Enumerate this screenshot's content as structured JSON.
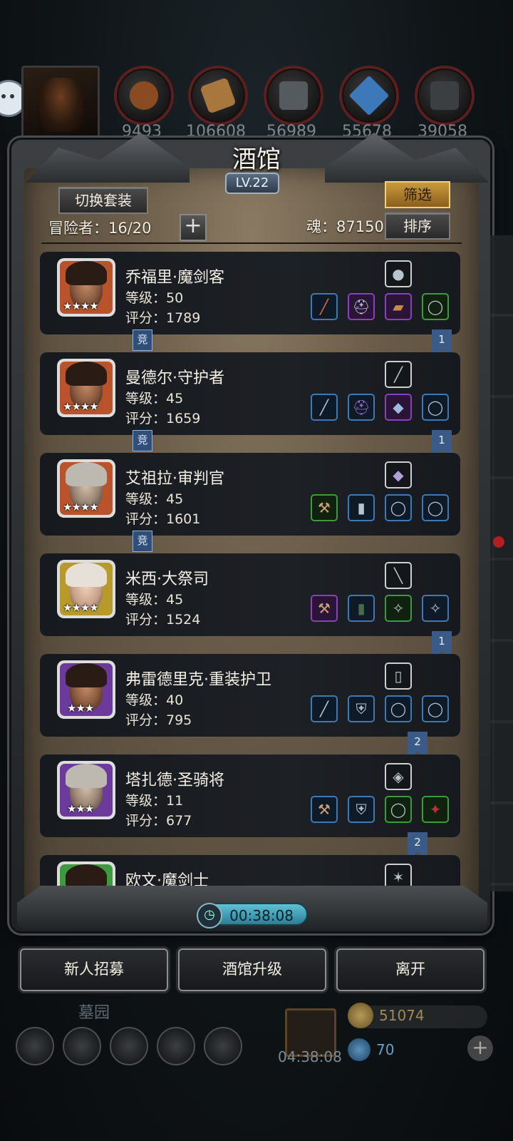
{
  "top_bar": {
    "resources": [
      {
        "name": "meat",
        "value": "9493"
      },
      {
        "name": "wood",
        "value": "106608"
      },
      {
        "name": "stone",
        "value": "56989"
      },
      {
        "name": "crystal",
        "value": "55678"
      },
      {
        "name": "iron",
        "value": "39058"
      }
    ]
  },
  "panel": {
    "title": "酒馆",
    "level": "LV.22",
    "switch_outfit_label": "切换套装",
    "filter_label": "筛选",
    "sort_label": "排序",
    "adventurers_label": "冒险者：16/20",
    "add_label": "+",
    "soul_label": "魂：87150"
  },
  "heroes": [
    {
      "name": "乔福里·魔剑客",
      "level": "等级：50",
      "score": "评分：1789",
      "stars": "★★★★",
      "frame_color": "#b8532b",
      "face": "dark",
      "competing": "竞",
      "ribbon": "1"
    },
    {
      "name": "曼德尔·守护者",
      "level": "等级：45",
      "score": "评分：1659",
      "stars": "★★★★",
      "frame_color": "#b8532b",
      "face": "dark",
      "competing": "竞",
      "ribbon": "1"
    },
    {
      "name": "艾祖拉·审判官",
      "level": "等级：45",
      "score": "评分：1601",
      "stars": "★★★★",
      "frame_color": "#b8532b",
      "face": "old",
      "competing": "竞",
      "ribbon": ""
    },
    {
      "name": "米西·大祭司",
      "level": "等级：45",
      "score": "评分：1524",
      "stars": "★★★★",
      "frame_color": "#b79a2a",
      "face": "light",
      "competing": "",
      "ribbon": "1"
    },
    {
      "name": "弗雷德里克·重装护卫",
      "level": "等级：40",
      "score": "评分：795",
      "stars": "★★★",
      "frame_color": "#6b3a9a",
      "face": "dark",
      "competing": "",
      "ribbon": "2"
    },
    {
      "name": "塔扎德·圣骑将",
      "level": "等级：11",
      "score": "评分：677",
      "stars": "★★★",
      "frame_color": "#6b3a9a",
      "face": "old",
      "competing": "",
      "ribbon": "2"
    },
    {
      "name": "欧文·魔剑士",
      "level": "",
      "score": "",
      "stars": "",
      "frame_color": "#3e9a3e",
      "face": "dark",
      "competing": "",
      "ribbon": ""
    }
  ],
  "timer": "00:38:08",
  "actions": {
    "recruit": "新人招募",
    "upgrade": "酒馆升级",
    "leave": "离开"
  },
  "hud": {
    "area": "墓园",
    "gift_timer": "04:38:08",
    "gold": "51074",
    "gems": "70"
  }
}
